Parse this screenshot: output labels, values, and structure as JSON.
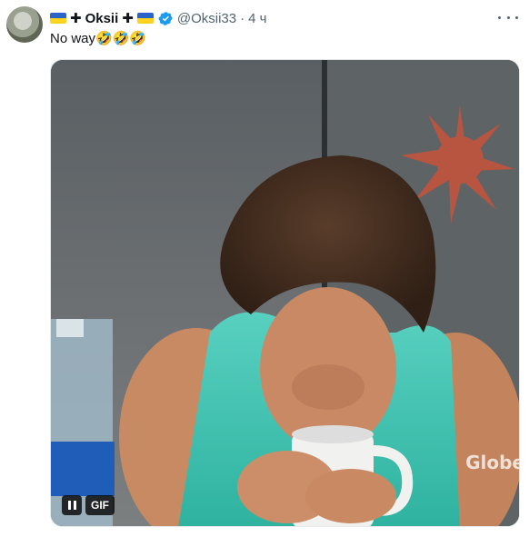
{
  "tweet": {
    "author_flag_left": "ukraine-flag-icon",
    "author_prefix_symbol": "✚",
    "author_name": "Oksii",
    "author_suffix_symbol": "✚",
    "author_flag_right": "ukraine-flag-icon",
    "verified_icon": "verified-badge-icon",
    "handle": "@Oksii33",
    "separator": "·",
    "time": "4 ч",
    "more_icon": "more-options-icon",
    "text": "No way🤣🤣🤣",
    "media": {
      "type": "gif",
      "gif_label": "GIF",
      "pause_icon": "pause-icon",
      "watermark": "Globe"
    }
  },
  "colors": {
    "text_primary": "#0f1419",
    "text_secondary": "#536471",
    "verified_blue": "#1d9bf0",
    "flag_blue": "#2b63c6",
    "flag_yellow": "#ffd21f"
  }
}
